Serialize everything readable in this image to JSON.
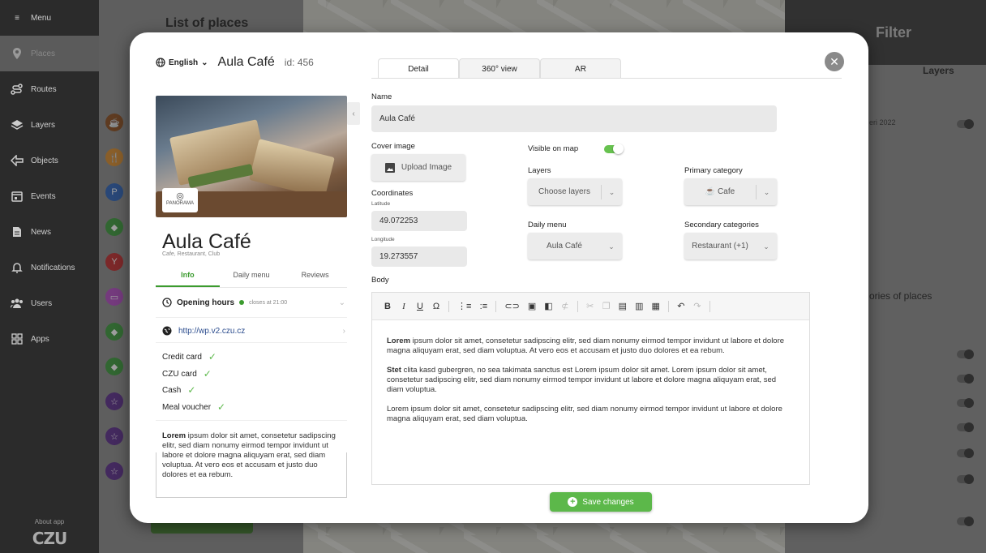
{
  "sidebar": {
    "menu_label": "Menu",
    "items": [
      {
        "label": "Places",
        "icon": "pin-icon"
      },
      {
        "label": "Routes",
        "icon": "route-icon"
      },
      {
        "label": "Layers",
        "icon": "layers-icon"
      },
      {
        "label": "Objects",
        "icon": "objects-icon"
      },
      {
        "label": "Events",
        "icon": "calendar-icon"
      },
      {
        "label": "News",
        "icon": "news-icon"
      },
      {
        "label": "Notifications",
        "icon": "bell-icon"
      },
      {
        "label": "Users",
        "icon": "users-icon"
      },
      {
        "label": "Apps",
        "icon": "apps-icon"
      }
    ],
    "about": "About app",
    "logo": "CZU"
  },
  "background": {
    "list_title": "List of places",
    "filter_title": "Filter",
    "filter_tab": "Layers",
    "filter_item": "eri 2022",
    "filter_section": "ories of places"
  },
  "modal": {
    "language": "English",
    "title": "Aula Café",
    "id_text": "id: 456",
    "tabs": [
      "Detail",
      "360° view",
      "AR"
    ],
    "place": {
      "name": "Aula Café",
      "categories": "Cafe, Restaurant, Club",
      "panorama_label": "PANORAMA"
    },
    "left_tabs": [
      "Info",
      "Daily menu",
      "Reviews"
    ],
    "opening_hours": {
      "label": "Opening hours",
      "status": "closes at 21:00"
    },
    "website": "http://wp.v2.czu.cz",
    "payments": [
      "Credit card",
      "CZU card",
      "Cash",
      "Meal voucher"
    ],
    "description": {
      "bold": "Lorem",
      "text": " ipsum dolor sit amet, consetetur sadipscing elitr, sed diam nonumy eirmod tempor invidunt ut labore et dolore magna aliquyam erat, sed diam voluptua. At vero eos et accusam et justo duo dolores et ea rebum."
    },
    "form": {
      "name_label": "Name",
      "name_value": "Aula Café",
      "cover_label": "Cover image",
      "upload_label": "Upload Image",
      "coords_label": "Coordinates",
      "lat_label": "Latitude",
      "lat_value": "49.072253",
      "lng_label": "Longitude",
      "lng_value": "19.273557",
      "visible_label": "Visible on map",
      "visible_on": true,
      "layers_label": "Layers",
      "layers_value": "Choose layers",
      "primary_label": "Primary category",
      "primary_value": "Cafe",
      "daily_label": "Daily menu",
      "daily_value": "Aula Café",
      "secondary_label": "Secondary categories",
      "secondary_value": "Restaurant (+1)",
      "body_label": "Body"
    },
    "body_paragraphs": [
      {
        "bold": "Lorem",
        "text": " ipsum dolor sit amet, consetetur sadipscing elitr, sed diam nonumy eirmod tempor invidunt ut labore et dolore magna aliquyam erat, sed diam voluptua. At vero eos et accusam et justo duo dolores et ea rebum."
      },
      {
        "bold": "Stet",
        "text": " clita kasd gubergren, no sea takimata sanctus est Lorem ipsum dolor sit amet. Lorem ipsum dolor sit amet, consetetur sadipscing elitr, sed diam nonumy eirmod tempor invidunt ut labore et dolore magna aliquyam erat, sed diam voluptua."
      },
      {
        "bold": "",
        "text": "Lorem ipsum dolor sit amet, consetetur sadipscing elitr, sed diam nonumy eirmod tempor invidunt ut labore et dolore magna aliquyam erat, sed diam voluptua."
      }
    ],
    "save_label": "Save changes"
  },
  "colors": {
    "accent": "#5cb84a",
    "sidebar": "#2b2b2b"
  }
}
